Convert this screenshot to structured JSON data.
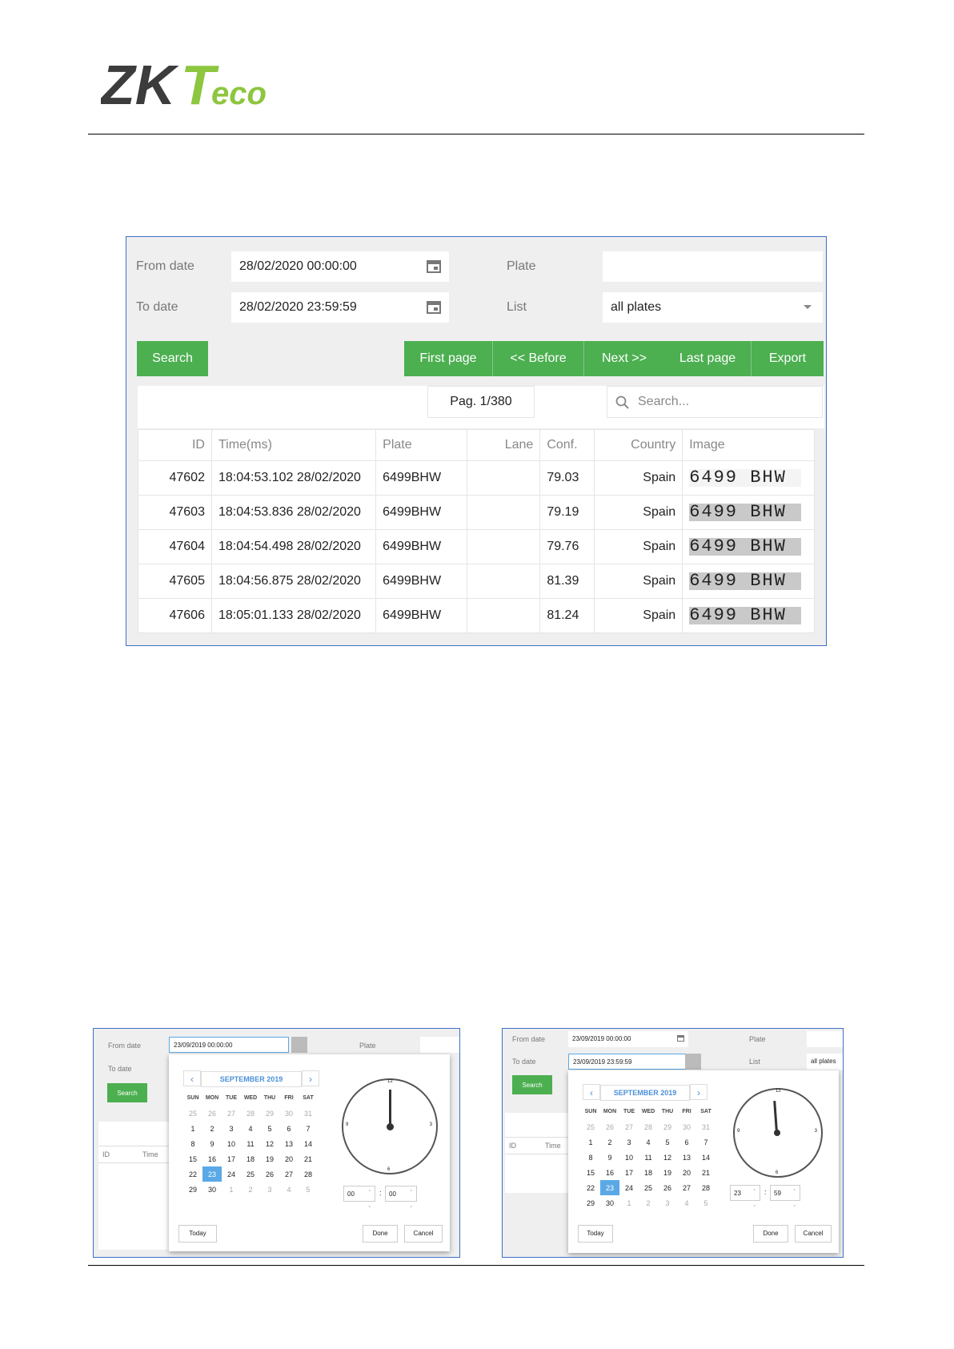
{
  "logo": {
    "part1": "ZK",
    "part2": "T",
    "part3": "eco",
    "brand_green": "#8dc63f",
    "brand_gray": "#3c3c3c"
  },
  "main": {
    "from_label": "From date",
    "from_value": "28/02/2020 00:00:00",
    "to_label": "To date",
    "to_value": "28/02/2020 23:59:59",
    "plate_label": "Plate",
    "plate_value": "",
    "list_label": "List",
    "list_value": "all plates",
    "search_btn": "Search",
    "first_btn": "First page",
    "before_btn": "<< Before",
    "next_btn": "Next >>",
    "last_btn": "Last page",
    "export_btn": "Export",
    "page_indicator": "Pag. 1/380",
    "search_placeholder": "Search...",
    "accent": "#4caf50",
    "columns": [
      "ID",
      "Time(ms)",
      "Plate",
      "Lane",
      "Conf.",
      "Country",
      "Image"
    ],
    "rows": [
      {
        "id": "47602",
        "time": "18:04:53.102 28/02/2020",
        "plate": "6499BHW",
        "lane": "",
        "conf": "79.03",
        "country": "Spain",
        "image": "6499 BHW"
      },
      {
        "id": "47603",
        "time": "18:04:53.836 28/02/2020",
        "plate": "6499BHW",
        "lane": "",
        "conf": "79.19",
        "country": "Spain",
        "image": "6499 BHW"
      },
      {
        "id": "47604",
        "time": "18:04:54.498 28/02/2020",
        "plate": "6499BHW",
        "lane": "",
        "conf": "79.76",
        "country": "Spain",
        "image": "6499 BHW"
      },
      {
        "id": "47605",
        "time": "18:04:56.875 28/02/2020",
        "plate": "6499BHW",
        "lane": "",
        "conf": "81.39",
        "country": "Spain",
        "image": "6499 BHW"
      },
      {
        "id": "47606",
        "time": "18:05:01.133 28/02/2020",
        "plate": "6499BHW",
        "lane": "",
        "conf": "81.24",
        "country": "Spain",
        "image": "6499 BHW"
      }
    ]
  },
  "picker_left": {
    "from_label": "From date",
    "from_value": "23/09/2019 00:00:00",
    "to_label": "To date",
    "plate_label": "Plate",
    "search_btn": "Search",
    "col_id": "ID",
    "col_time": "Time",
    "month": "SEPTEMBER 2019",
    "hour": "00",
    "minute": "00",
    "today_btn": "Today",
    "done_btn": "Done",
    "cancel_btn": "Cancel"
  },
  "picker_right": {
    "from_label": "From date",
    "from_value": "23/09/2019 00:00:00",
    "to_label": "To date",
    "to_value": "23/09/2019 23:59:59",
    "plate_label": "Plate",
    "list_label": "List",
    "list_value": "all plates",
    "search_btn": "Search",
    "col_id": "ID",
    "col_time": "Time",
    "month": "SEPTEMBER 2019",
    "hour": "23",
    "minute": "59",
    "today_btn": "Today",
    "done_btn": "Done",
    "cancel_btn": "Cancel"
  },
  "calendar": {
    "weekdays": [
      "SUN",
      "MON",
      "TUE",
      "WED",
      "THU",
      "FRI",
      "SAT"
    ],
    "weeks": [
      [
        "25",
        "26",
        "27",
        "28",
        "29",
        "30",
        "31"
      ],
      [
        "1",
        "2",
        "3",
        "4",
        "5",
        "6",
        "7"
      ],
      [
        "8",
        "9",
        "10",
        "11",
        "12",
        "13",
        "14"
      ],
      [
        "15",
        "16",
        "17",
        "18",
        "19",
        "20",
        "21"
      ],
      [
        "22",
        "23",
        "24",
        "25",
        "26",
        "27",
        "28"
      ],
      [
        "29",
        "30",
        "1",
        "2",
        "3",
        "4",
        "5"
      ]
    ],
    "selected": "23",
    "clock_numbers": [
      "12",
      "3",
      "6",
      "9"
    ]
  }
}
